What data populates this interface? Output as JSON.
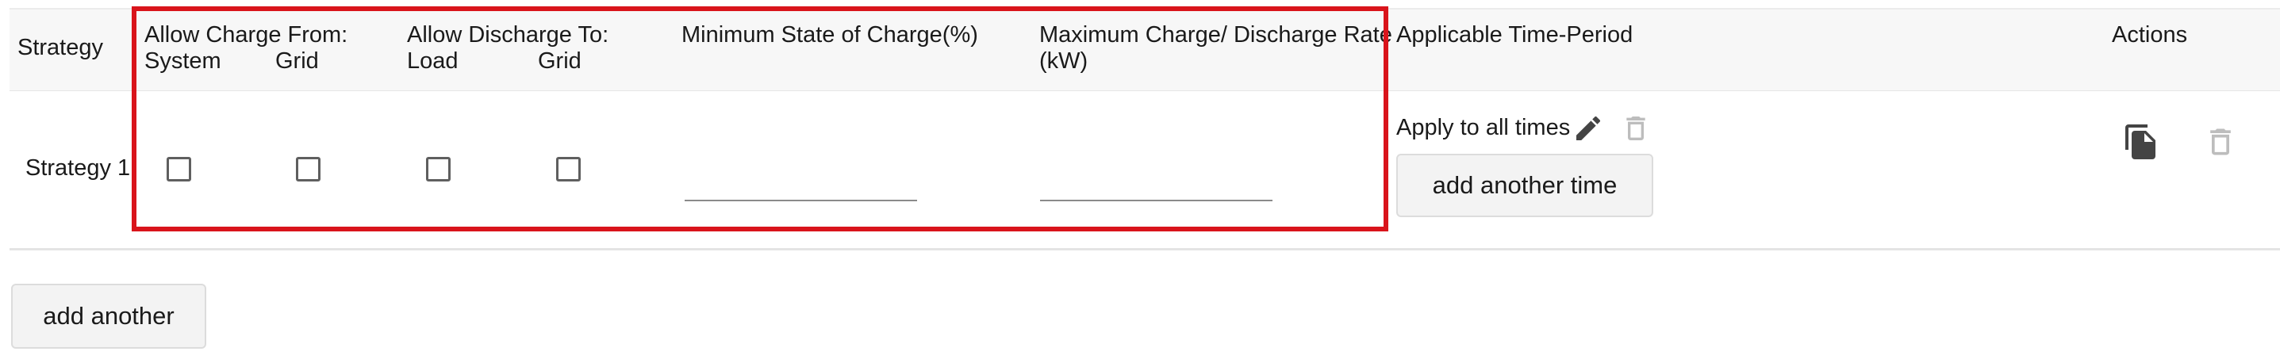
{
  "header": {
    "strategy": "Strategy",
    "allow_charge_from": "Allow Charge From:",
    "charge_system": "System",
    "charge_grid": "Grid",
    "allow_discharge_to": "Allow Discharge To:",
    "discharge_load": "Load",
    "discharge_grid": "Grid",
    "min_soc": "Minimum State of Charge(%)",
    "max_rate_line1": "Maximum Charge/ Discharge Rate",
    "max_rate_line2": "(kW)",
    "time_period": "Applicable Time-Period",
    "actions": "Actions"
  },
  "row": {
    "name": "Strategy 1",
    "charge_system_checked": false,
    "charge_grid_checked": false,
    "discharge_load_checked": false,
    "discharge_grid_checked": false,
    "min_soc_value": "",
    "max_rate_value": "",
    "time_text": "Apply to all times",
    "add_time_label": "add another time"
  },
  "footer": {
    "add_another_label": "add another"
  },
  "colors": {
    "highlight": "#d9141b",
    "icon_dark": "#444444",
    "icon_disabled": "#bdbdbd"
  },
  "icons": [
    "edit-icon",
    "delete-icon",
    "copy-icon"
  ]
}
